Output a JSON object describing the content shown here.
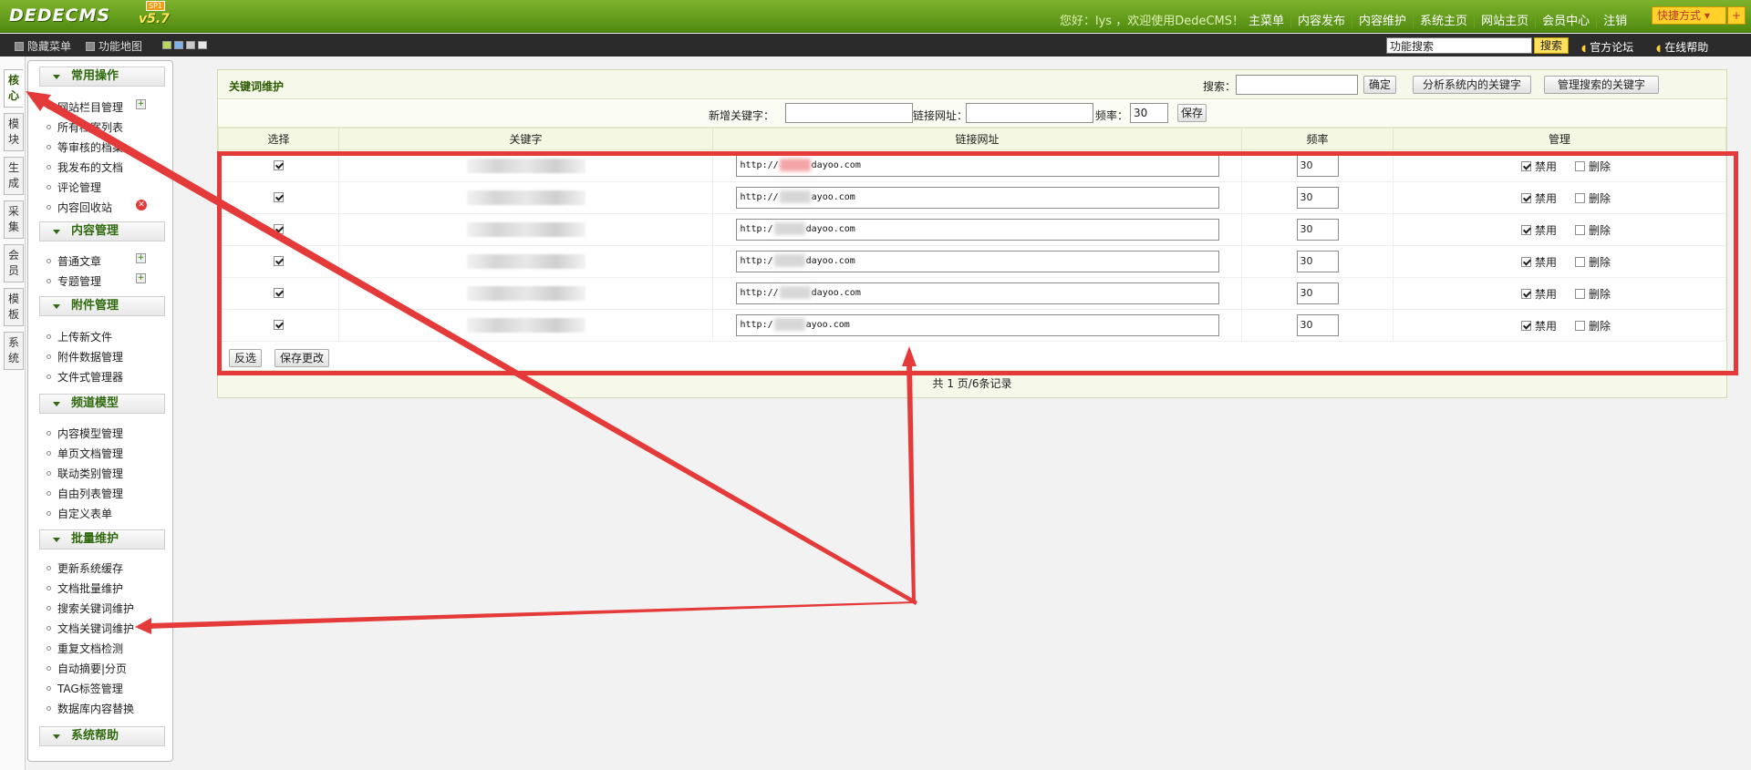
{
  "topbar": {
    "logo": "DEDECMS",
    "version": "v5.7",
    "badge": "SP1",
    "welcome": "您好：lys ，欢迎使用DedeCMS！",
    "nav": [
      "主菜单",
      "内容发布",
      "内容维护",
      "系统主页",
      "网站主页",
      "会员中心",
      "注销"
    ],
    "quick_label": "快捷方式",
    "quick_plus": "+"
  },
  "subbar": {
    "hide_menu": "隐藏菜单",
    "function_map": "功能地图",
    "search_value": "功能搜索",
    "search_button": "搜索",
    "official_forum": "官方论坛",
    "online_help": "在线帮助"
  },
  "left_tabs": [
    "核心",
    "模块",
    "生成",
    "采集",
    "会员",
    "模板",
    "系统"
  ],
  "menu": {
    "groups": [
      {
        "title": "常用操作",
        "items": [
          "网站栏目管理",
          "所有档案列表",
          "等审核的档案",
          "我发布的文档",
          "评论管理",
          "内容回收站"
        ]
      },
      {
        "title": "内容管理",
        "items": [
          "普通文章",
          "专题管理"
        ]
      },
      {
        "title": "附件管理",
        "items": [
          "上传新文件",
          "附件数据管理",
          "文件式管理器"
        ]
      },
      {
        "title": "频道模型",
        "items": [
          "内容模型管理",
          "单页文档管理",
          "联动类别管理",
          "自由列表管理",
          "自定义表单"
        ]
      },
      {
        "title": "批量维护",
        "items": [
          "更新系统缓存",
          "文档批量维护",
          "搜索关键词维护",
          "文档关键词维护",
          "重复文档检测",
          "自动摘要|分页",
          "TAG标签管理",
          "数据库内容替换"
        ]
      },
      {
        "title": "系统帮助",
        "items": []
      }
    ]
  },
  "panel": {
    "title": "关键词维护",
    "search_label": "搜索：",
    "search_value": "",
    "confirm_button": "确定",
    "analyze_button": "分析系统内的关键字",
    "manage_button": "管理搜索的关键字",
    "add_keyword_label": "新增关键字：",
    "add_keyword_value": "",
    "add_link_label": "链接网址：",
    "add_link_value": "",
    "add_rate_label": "频率：",
    "add_rate_value": "30",
    "save_button": "保存",
    "columns": [
      "选择",
      "关键字",
      "链接网址",
      "频率",
      "管理"
    ],
    "rows": [
      {
        "url_prefix": "http://",
        "url_suffix": "dayoo.com",
        "rate": "30",
        "disable": "禁用",
        "delete": "删除"
      },
      {
        "url_prefix": "http://",
        "url_suffix": "ayoo.com",
        "rate": "30",
        "disable": "禁用",
        "delete": "删除"
      },
      {
        "url_prefix": "http:/",
        "url_suffix": "dayoo.com",
        "rate": "30",
        "disable": "禁用",
        "delete": "删除"
      },
      {
        "url_prefix": "http:/",
        "url_suffix": "dayoo.com",
        "rate": "30",
        "disable": "禁用",
        "delete": "删除"
      },
      {
        "url_prefix": "http://",
        "url_suffix": "dayoo.com",
        "rate": "30",
        "disable": "禁用",
        "delete": "删除"
      },
      {
        "url_prefix": "http:/",
        "url_suffix": "ayoo.com",
        "rate": "30",
        "disable": "禁用",
        "delete": "删除"
      }
    ],
    "invert_button": "反选",
    "save_changes_button": "保存更改",
    "pager": "共 1 页/6条记录"
  },
  "colors": {
    "highlight": "#e53a3a",
    "brand_green": "#5a9a14",
    "title_green": "#2b5a00"
  }
}
